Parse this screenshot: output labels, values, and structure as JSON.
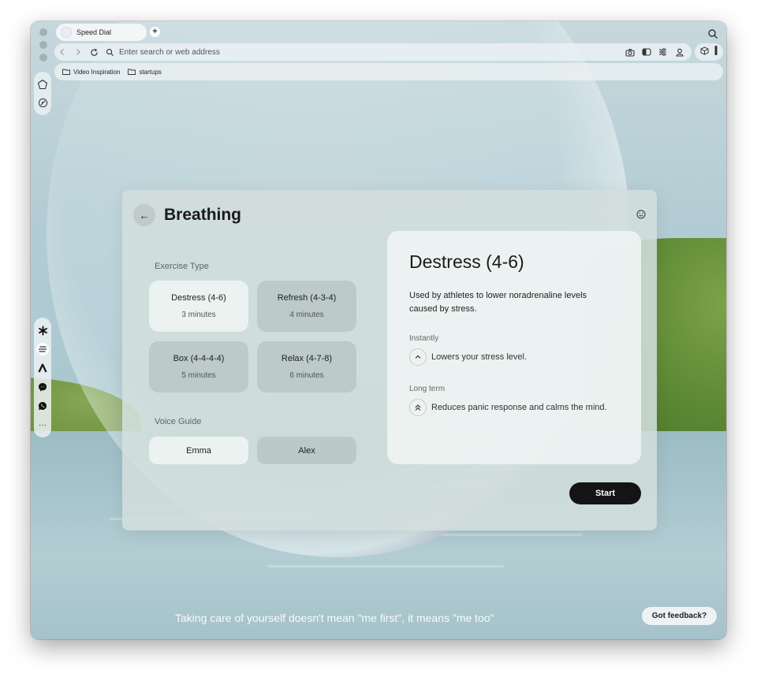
{
  "browser": {
    "tab_title": "Speed Dial",
    "new_tab_label": "+",
    "address_placeholder": "Enter search or web address",
    "bookmarks": [
      {
        "label": "Video Inspiration",
        "icon": "folder-icon"
      },
      {
        "label": "startups",
        "icon": "folder-icon"
      }
    ],
    "sidebar_top_icons": [
      "home-icon",
      "leaf-icon"
    ],
    "sidebar_apps": [
      "asterisk-app-icon",
      "breathing-app-icon",
      "arc-app-icon",
      "messenger-icon",
      "whatsapp-icon",
      "more-icon"
    ],
    "sidebar_more_label": "···"
  },
  "panel": {
    "back_label": "←",
    "title": "Breathing",
    "exercise_type_label": "Exercise Type",
    "exercises": [
      {
        "name": "Destress (4-6)",
        "duration": "3 minutes",
        "selected": true
      },
      {
        "name": "Refresh (4-3-4)",
        "duration": "4 minutes",
        "selected": false
      },
      {
        "name": "Box (4-4-4-4)",
        "duration": "5 minutes",
        "selected": false
      },
      {
        "name": "Relax (4-7-8)",
        "duration": "6 minutes",
        "selected": false
      }
    ],
    "voice_guide_label": "Voice Guide",
    "voices": [
      {
        "name": "Emma",
        "selected": true
      },
      {
        "name": "Alex",
        "selected": false
      }
    ],
    "detail": {
      "title": "Destress (4-6)",
      "description": "Used by athletes to lower noradrenaline levels caused by stress.",
      "instantly_label": "Instantly",
      "instantly_text": "Lowers your stress level.",
      "longterm_label": "Long term",
      "longterm_text": "Reduces panic response and calms the mind."
    },
    "start_label": "Start"
  },
  "footer": {
    "quote": "Taking care of yourself doesn't mean \"me first\", it means \"me too\"",
    "feedback_label": "Got feedback?"
  }
}
